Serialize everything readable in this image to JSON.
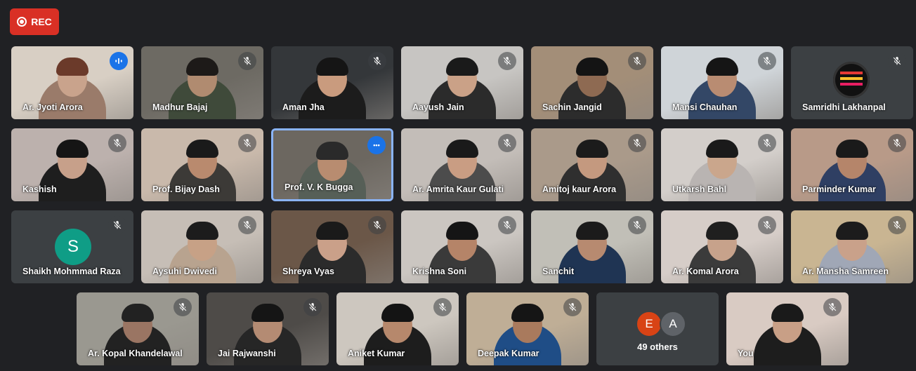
{
  "recording": {
    "label": "REC",
    "color": "#d93025"
  },
  "icons": {
    "mic_off": "mic-off-icon",
    "speaking": "audio-level-icon",
    "more": "more-options-icon"
  },
  "participants": [
    {
      "name": "Ar. Jyoti Arora",
      "state": "speaking"
    },
    {
      "name": "Madhur Bajaj",
      "state": "muted"
    },
    {
      "name": "Aman Jha",
      "state": "muted"
    },
    {
      "name": "Aayush Jain",
      "state": "muted"
    },
    {
      "name": "Sachin Jangid",
      "state": "muted"
    },
    {
      "name": "Mansi Chauhan",
      "state": "muted"
    },
    {
      "name": "Samridhi Lakhanpal",
      "state": "muted"
    },
    {
      "name": "Kashish",
      "state": "muted"
    },
    {
      "name": "Prof. Bijay Dash",
      "state": "muted"
    },
    {
      "name": "Prof. V. K Bugga",
      "state": "active"
    },
    {
      "name": "Ar. Amrita Kaur Gulati",
      "state": "muted"
    },
    {
      "name": "Amitoj kaur Arora",
      "state": "muted"
    },
    {
      "name": "Utkarsh Bahl",
      "state": "muted"
    },
    {
      "name": "Parminder Kumar",
      "state": "muted"
    },
    {
      "name": "Shaikh Mohmmad Raza",
      "state": "muted",
      "avatar_letter": "S",
      "avatar_color": "#0f9d86"
    },
    {
      "name": "Aysuhi Dwivedi",
      "state": "muted"
    },
    {
      "name": "Shreya Vyas",
      "state": "muted"
    },
    {
      "name": "Krishna Soni",
      "state": "muted"
    },
    {
      "name": "Sanchit",
      "state": "muted"
    },
    {
      "name": "Ar. Komal Arora",
      "state": "muted"
    },
    {
      "name": "Ar. Mansha Samreen",
      "state": "muted"
    },
    {
      "name": "Ar. Kopal Khandelawal",
      "state": "muted"
    },
    {
      "name": "Jai Rajwanshi",
      "state": "muted"
    },
    {
      "name": "Aniket Kumar",
      "state": "muted"
    },
    {
      "name": "Deepak Kumar",
      "state": "muted"
    },
    {
      "name": "You",
      "state": "muted"
    }
  ],
  "others": {
    "label": "49 others",
    "avatars": [
      {
        "letter": "E",
        "color": "#d84315"
      },
      {
        "letter": "A",
        "color": "#5f6368"
      }
    ]
  },
  "colors": {
    "background": "#202124",
    "tile": "#3c4043",
    "active_border": "#8ab4f8",
    "accent": "#1a73e8"
  }
}
